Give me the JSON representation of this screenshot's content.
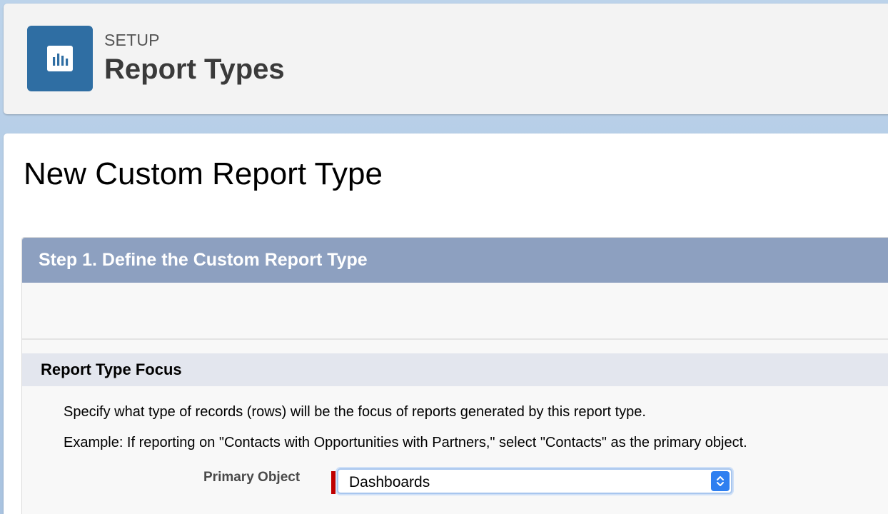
{
  "header": {
    "icon": "report-chart-icon",
    "kicker": "SETUP",
    "title": "Report Types"
  },
  "page": {
    "title": "New Custom Report Type"
  },
  "step": {
    "title": "Step 1. Define the Custom Report Type"
  },
  "section": {
    "title": "Report Type Focus",
    "description": "Specify what type of records (rows) will be the focus of reports generated by this report type.",
    "example": "Example: If reporting on \"Contacts with Opportunities with Partners,\" select \"Contacts\" as the primary object."
  },
  "primary_object": {
    "label": "Primary Object",
    "value": "Dashboards",
    "required": true,
    "stepper_icon": "chevron-updown-icon"
  },
  "colors": {
    "header_icon_bg": "#2f6ea3",
    "step_header_bg": "#8da0c0",
    "section_bar_bg": "#e3e6ee",
    "required_marker": "#c00000",
    "select_stepper_bg": "#2f7ff0"
  }
}
